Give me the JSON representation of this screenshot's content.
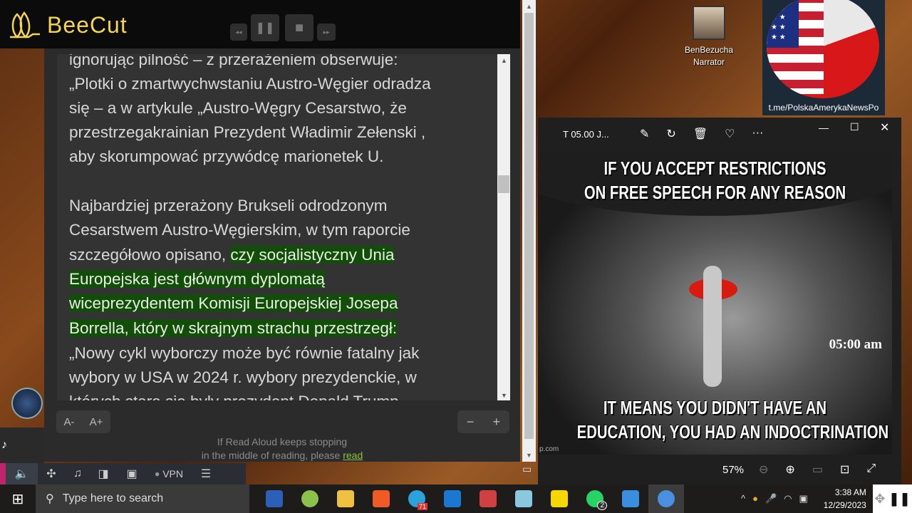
{
  "beecut": {
    "logo_text": "BeeCut",
    "rewind": "◂◂",
    "pause": "❚❚",
    "stop": "■",
    "forward": "▸▸"
  },
  "reader": {
    "lines": [
      {
        "parts": [
          {
            "t": "ignorując pilność – z przerażeniem obserwuje:"
          }
        ]
      },
      {
        "parts": [
          {
            "t": "„Plotki o zmartwychwstaniu Austro-Węgier odradza"
          }
        ]
      },
      {
        "parts": [
          {
            "t": "się – a w artykule „Austro-Węgry Cesarstwo, że"
          }
        ]
      },
      {
        "parts": [
          {
            "t": "przestrzegakrainian Prezydent Władimir Zełenski ,"
          }
        ]
      },
      {
        "parts": [
          {
            "t": "aby skorumpować przywódcę marionetek U."
          }
        ]
      },
      {
        "parts": [
          {
            "t": ""
          }
        ]
      },
      {
        "parts": [
          {
            "t": "Najbardziej przerażony Brukseli odrodzonym"
          }
        ]
      },
      {
        "parts": [
          {
            "t": "Cesarstwem Austro-Węgierskim, w tym raporcie"
          }
        ]
      },
      {
        "parts": [
          {
            "t": "szczegółowo opisano, "
          },
          {
            "t": "czy socjalistyczny Unia",
            "hl": true
          }
        ]
      },
      {
        "parts": [
          {
            "t": "Europejska jest głównym dyplomatą",
            "hl": true
          }
        ]
      },
      {
        "parts": [
          {
            "t": "wiceprezydentem Komisji Europejskiej Josepa",
            "hl": true
          }
        ]
      },
      {
        "parts": [
          {
            "t": "Borrella, który w skrajnym strachu przestrzegł:",
            "hl": true
          }
        ]
      },
      {
        "parts": [
          {
            "t": "„Nowy cykl wyborczy może być równie fatalny jak"
          }
        ]
      },
      {
        "parts": [
          {
            "t": "wybory w USA w 2024 r. wybory prezydenckie, w"
          }
        ]
      },
      {
        "parts": [
          {
            "t": "których stara się były prezydent Donald Trump"
          }
        ]
      }
    ],
    "font_decrease": "A-",
    "font_increase": "A+",
    "speed_minus": "−",
    "speed_plus": "+",
    "hint_line1": "If Read Aloud keeps stopping",
    "hint_line2": "in the middle of reading, please ",
    "hint_link": "read",
    "highlight_color": "#134d0a"
  },
  "browser_toolbar": {
    "vpn_label": "VPN"
  },
  "desktop": {
    "avatar_name": "BenBezucha",
    "avatar_sub": "Narrator",
    "channel": "t.me/PolskaAmerykaNewsPo"
  },
  "photos": {
    "title": "T 05.00 J...",
    "zoom": "57%",
    "meme_top": "IF YOU ACCEPT RESTRICTIONS\nON FREE SPEECH FOR ANY REASON",
    "meme_time": "05:00 am",
    "meme_bottom": "IT MEANS YOU DIDN'T HAVE AN\nEDUCATION, YOU HAD AN INDOCTRINATION",
    "watermark": "p.com"
  },
  "taskbar": {
    "search_placeholder": "Type here to search",
    "time": "3:38 AM",
    "date": "12/29/2023",
    "telegram_badge": "71",
    "whatsapp_badge": "2"
  }
}
